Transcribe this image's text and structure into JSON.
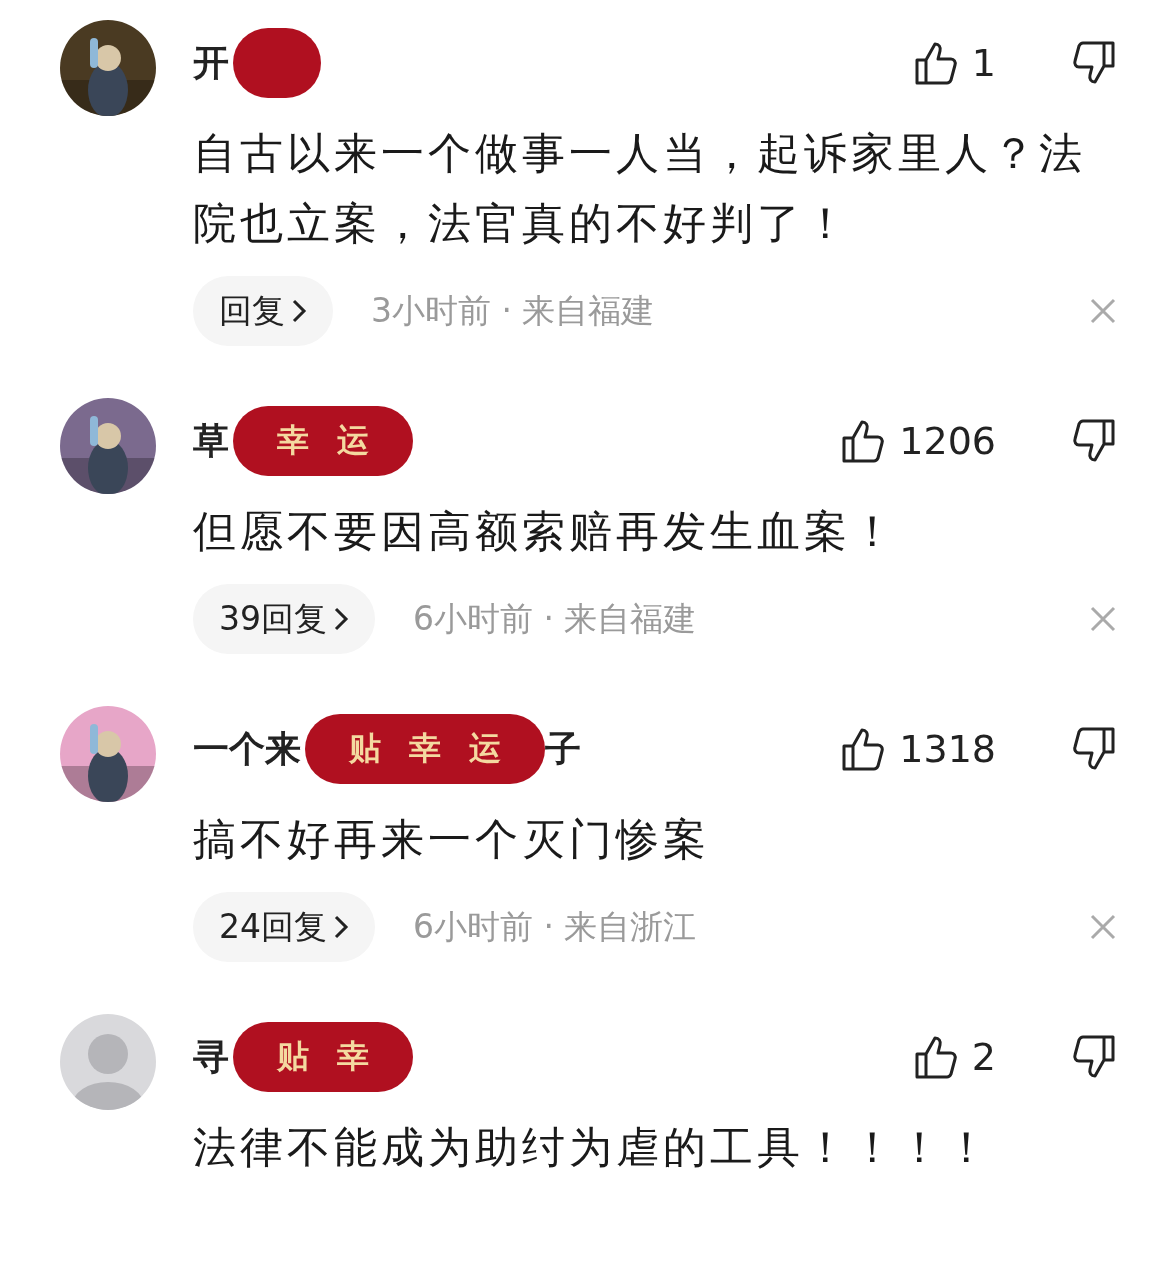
{
  "comments": [
    {
      "avatar": {
        "kind": "picture",
        "color": "#4a3a22"
      },
      "name_start": "开",
      "likes": "1",
      "text": "自古以来一个做事一人当，起诉家里人？法院也立案，法官真的不好判了！",
      "reply": "回复",
      "meta": "3小时前 · 来自福建"
    },
    {
      "avatar": {
        "kind": "picture",
        "color": "#7b6a8e"
      },
      "name_start": "草",
      "stickers": [
        "幸",
        "运"
      ],
      "likes": "1206",
      "text": "但愿不要因高额索赔再发生血案！",
      "reply": "39回复",
      "meta": "6小时前 · 来自福建"
    },
    {
      "avatar": {
        "kind": "picture",
        "color": "#e7a6c8"
      },
      "name_start": "一个来",
      "stickers": [
        "贴",
        "幸",
        "运"
      ],
      "name_end": "子",
      "likes": "1318",
      "text": "搞不好再来一个灭门惨案",
      "reply": "24回复",
      "meta": "6小时前 · 来自浙江"
    },
    {
      "avatar": {
        "kind": "default",
        "color": "#d9d9dc"
      },
      "name_start": "寻",
      "stickers": [
        "贴",
        "幸"
      ],
      "likes": "2",
      "text": "法律不能成为助纣为虐的工具！！！！"
    }
  ]
}
